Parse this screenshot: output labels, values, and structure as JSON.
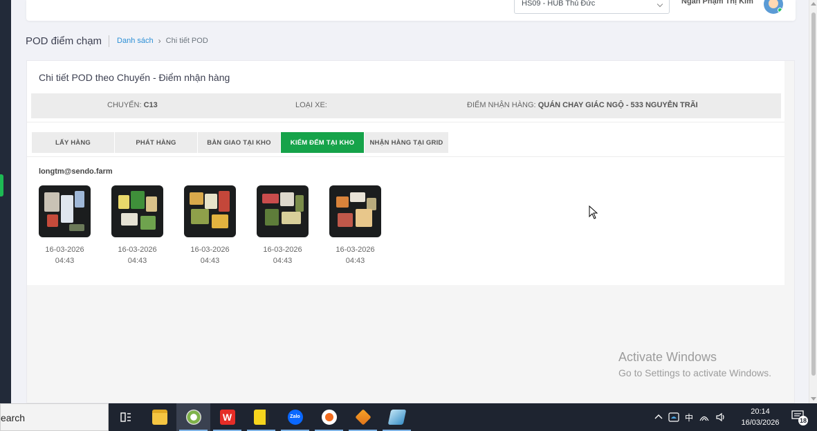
{
  "topbar": {
    "hub_select_value": "HS09 - HUB Thủ Đức",
    "user_name": "Ngân Phạm Thị Kim"
  },
  "header": {
    "page_title": "POD điểm chạm",
    "breadcrumb_link": "Danh sách",
    "breadcrumb_sep": "›",
    "breadcrumb_current": "Chi tiết POD"
  },
  "card": {
    "title": "Chi tiết POD theo Chuyến - Điểm nhận hàng",
    "trip_label": "CHUYẾN:",
    "trip_value": "C13",
    "vehicle_label": "LOẠI XE:",
    "vehicle_value": "",
    "pickup_label": "ĐIỂM NHẬN HÀNG:",
    "pickup_value": "QUÁN CHAY GIÁC NGỘ - 533 NGUYỄN TRÃI"
  },
  "tabs": [
    {
      "label": "LẤY HÀNG",
      "active": false
    },
    {
      "label": "PHÁT HÀNG",
      "active": false
    },
    {
      "label": "BÀN GIAO TẠI KHO",
      "active": false
    },
    {
      "label": "KIỂM ĐẾM TẠI KHO",
      "active": true
    },
    {
      "label": "NHẬN HÀNG TẠI GRID",
      "active": false
    }
  ],
  "uploader": "longtm@sendo.farm",
  "photos": [
    {
      "date": "16-03-2026",
      "time": "04:43"
    },
    {
      "date": "16-03-2026",
      "time": "04:43"
    },
    {
      "date": "16-03-2026",
      "time": "04:43"
    },
    {
      "date": "16-03-2026",
      "time": "04:43"
    },
    {
      "date": "16-03-2026",
      "time": "04:43"
    }
  ],
  "watermark": {
    "line1": "Activate Windows",
    "line2": "Go to Settings to activate Windows."
  },
  "taskbar": {
    "search_text": "earch",
    "clock_time": "20:14",
    "clock_date": "16/03/2026",
    "notification_count": "18",
    "ime_label": "中",
    "apps": [
      "task-view-icon",
      "file-explorer-icon",
      "browser-icon",
      "wps-icon",
      "sticky-notes-icon",
      "zalo-icon",
      "remote-access-icon",
      "sublime-icon",
      "app-icon"
    ]
  },
  "colors": {
    "accent_green": "#16a34a",
    "link_blue": "#2b8fd6",
    "taskbar_bg": "#1e2430"
  }
}
